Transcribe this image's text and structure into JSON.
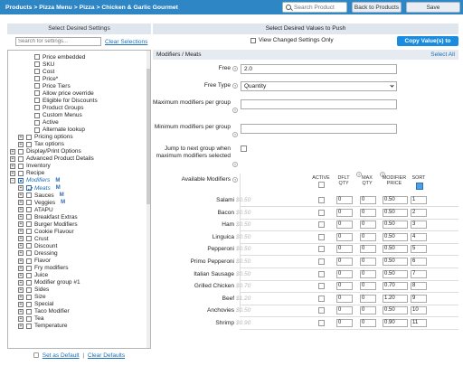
{
  "topbar": {
    "breadcrumb": "Products > Pizza Menu > Pizza > Chicken & Garlic Gourmet",
    "search_placeholder": "Search Product",
    "back_label": "Back to Products",
    "save_label": "Save"
  },
  "left": {
    "title": "Select Desired Settings",
    "filter_placeholder": "Search for settings...",
    "clear_selections": "Clear Selections",
    "set_default": "Set as Default",
    "separator": "|",
    "clear_defaults": "Clear Defaults",
    "items": [
      {
        "label": "Price embedded",
        "indent": 2,
        "expander": "",
        "state": "off"
      },
      {
        "label": "SKU",
        "indent": 2,
        "expander": "",
        "state": "off"
      },
      {
        "label": "Cost",
        "indent": 2,
        "expander": "",
        "state": "off"
      },
      {
        "label": "Price*",
        "indent": 2,
        "expander": "",
        "state": "off"
      },
      {
        "label": "Price Tiers",
        "indent": 2,
        "expander": "",
        "state": "off"
      },
      {
        "label": "Allow price override",
        "indent": 2,
        "expander": "",
        "state": "off"
      },
      {
        "label": "Eligible for Discounts",
        "indent": 2,
        "expander": "",
        "state": "off"
      },
      {
        "label": "Product Groups",
        "indent": 2,
        "expander": "",
        "state": "off"
      },
      {
        "label": "Custom Menus",
        "indent": 2,
        "expander": "",
        "state": "off"
      },
      {
        "label": "Active",
        "indent": 2,
        "expander": "",
        "state": "off"
      },
      {
        "label": "Alternate lookup",
        "indent": 2,
        "expander": "",
        "state": "off"
      },
      {
        "label": "Pricing options",
        "indent": 1,
        "expander": "+",
        "state": "off"
      },
      {
        "label": "Tax options",
        "indent": 1,
        "expander": "+",
        "state": "off"
      },
      {
        "label": "Display/Print Options",
        "indent": 0,
        "expander": "+",
        "state": "off"
      },
      {
        "label": "Advanced Product Details",
        "indent": 0,
        "expander": "+",
        "state": "off"
      },
      {
        "label": "Inventory",
        "indent": 0,
        "expander": "+",
        "state": "off"
      },
      {
        "label": "Recipe",
        "indent": 0,
        "expander": "+",
        "state": "off"
      },
      {
        "label": "Modifiers",
        "indent": 0,
        "expander": "-",
        "state": "partial",
        "highlight": true,
        "badge": "M"
      },
      {
        "label": "Meats",
        "indent": 1,
        "expander": "+",
        "state": "on",
        "highlight": true,
        "badge": "M"
      },
      {
        "label": "Sauces",
        "indent": 1,
        "expander": "+",
        "state": "off",
        "badge": "M"
      },
      {
        "label": "Veggies",
        "indent": 1,
        "expander": "+",
        "state": "off",
        "badge": "M"
      },
      {
        "label": "ATAPU",
        "indent": 1,
        "expander": "+",
        "state": "off"
      },
      {
        "label": "Breakfast Extras",
        "indent": 1,
        "expander": "+",
        "state": "off"
      },
      {
        "label": "Burger Modifiers",
        "indent": 1,
        "expander": "+",
        "state": "off"
      },
      {
        "label": "Cookie Flavour",
        "indent": 1,
        "expander": "+",
        "state": "off"
      },
      {
        "label": "Crust",
        "indent": 1,
        "expander": "+",
        "state": "off"
      },
      {
        "label": "Discount",
        "indent": 1,
        "expander": "+",
        "state": "off"
      },
      {
        "label": "Dressing",
        "indent": 1,
        "expander": "+",
        "state": "off"
      },
      {
        "label": "Flavor",
        "indent": 1,
        "expander": "+",
        "state": "off"
      },
      {
        "label": "Fry modifiers",
        "indent": 1,
        "expander": "+",
        "state": "off"
      },
      {
        "label": "Juice",
        "indent": 1,
        "expander": "+",
        "state": "off"
      },
      {
        "label": "Modifier group #1",
        "indent": 1,
        "expander": "+",
        "state": "off"
      },
      {
        "label": "Sides",
        "indent": 1,
        "expander": "+",
        "state": "off"
      },
      {
        "label": "Size",
        "indent": 1,
        "expander": "+",
        "state": "off"
      },
      {
        "label": "Special",
        "indent": 1,
        "expander": "+",
        "state": "off"
      },
      {
        "label": "Taco Modifier",
        "indent": 1,
        "expander": "+",
        "state": "off"
      },
      {
        "label": "Tea",
        "indent": 1,
        "expander": "+",
        "state": "off"
      },
      {
        "label": "Temperature",
        "indent": 1,
        "expander": "+",
        "state": "off"
      }
    ]
  },
  "right": {
    "title": "Select Desired Values to Push",
    "view_changed": "View Changed Settings Only",
    "copy_button": "Copy Value(s) to",
    "section_title": "Modifiers / Meats",
    "select_all": "Select All",
    "help_glyph": "?",
    "fields": {
      "free_label": "Free",
      "free_value": "2.0",
      "free_type_label": "Free Type",
      "free_type_value": "Quantity",
      "max_label": "Maximum modifiers per group",
      "max_value": "",
      "min_label": "Minimum modifiers per group",
      "min_value": "",
      "jump_label_1": "Jump to next group when",
      "jump_label_2": "maximum modifiers selected",
      "available_label": "Available Modifiers"
    },
    "columns": {
      "active": "ACTIVE",
      "dflt_1": "DFLT",
      "dflt_2": "QTY",
      "max_1": "MAX",
      "max_2": "QTY",
      "price_1": "MODIFIER",
      "price_2": "PRICE",
      "sort": "SORT"
    },
    "modifiers": [
      {
        "name": "Salami",
        "default_price": "$0.50",
        "dflt_qty": "0",
        "max_qty": "0",
        "price": "0.50",
        "sort": "1"
      },
      {
        "name": "Bacon",
        "default_price": "$0.50",
        "dflt_qty": "0",
        "max_qty": "0",
        "price": "0.50",
        "sort": "2"
      },
      {
        "name": "Ham",
        "default_price": "$0.50",
        "dflt_qty": "0",
        "max_qty": "0",
        "price": "0.50",
        "sort": "3"
      },
      {
        "name": "Linguica",
        "default_price": "$0.50",
        "dflt_qty": "0",
        "max_qty": "0",
        "price": "0.50",
        "sort": "4"
      },
      {
        "name": "Pepperoni",
        "default_price": "$0.50",
        "dflt_qty": "0",
        "max_qty": "0",
        "price": "0.50",
        "sort": "5"
      },
      {
        "name": "Primo Pepperoni",
        "default_price": "$0.50",
        "dflt_qty": "0",
        "max_qty": "0",
        "price": "0.50",
        "sort": "6"
      },
      {
        "name": "Italian Sausage",
        "default_price": "$0.50",
        "dflt_qty": "0",
        "max_qty": "0",
        "price": "0.50",
        "sort": "7"
      },
      {
        "name": "Grilled Chicken",
        "default_price": "$0.70",
        "dflt_qty": "0",
        "max_qty": "0",
        "price": "0.70",
        "sort": "8"
      },
      {
        "name": "Beef",
        "default_price": "$1.20",
        "dflt_qty": "0",
        "max_qty": "0",
        "price": "1.20",
        "sort": "9"
      },
      {
        "name": "Anchovies",
        "default_price": "$0.50",
        "dflt_qty": "0",
        "max_qty": "0",
        "price": "0.50",
        "sort": "10"
      },
      {
        "name": "Shrimp",
        "default_price": "$0.90",
        "dflt_qty": "0",
        "max_qty": "0",
        "price": "0.90",
        "sort": "11"
      }
    ]
  },
  "colors": {
    "accent": "#2f86c4",
    "button_primary": "#1a8ce0",
    "link": "#1a6fb5",
    "header_bg": "#dfe6ee"
  }
}
